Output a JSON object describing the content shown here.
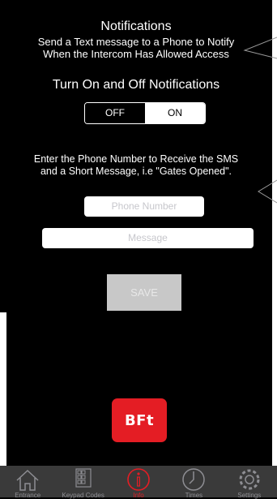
{
  "notifications": {
    "title": "Notifications",
    "description_line1": "Send a Text message to  a Phone to Notify",
    "description_line2": "When the Intercom Has Allowed Access",
    "toggle_heading": "Turn On and Off Notifications",
    "toggle": {
      "off_label": "OFF",
      "on_label": "ON",
      "selected": "ON"
    }
  },
  "sms": {
    "instruction_line1": "Enter the Phone Number to Receive the SMS",
    "instruction_line2": "and a Short Message, i.e \"Gates Opened\".",
    "phone_placeholder": "Phone Number",
    "message_placeholder": "Message",
    "save_label": "SAVE"
  },
  "logo": {
    "text": "BFt",
    "color": "#e41d24"
  },
  "tabs": [
    {
      "label": "Entrance",
      "icon": "home-icon"
    },
    {
      "label": "Keypad Codes",
      "icon": "keypad-icon"
    },
    {
      "label": "Info",
      "icon": "info-icon",
      "active": true
    },
    {
      "label": "Times",
      "icon": "clock-icon"
    },
    {
      "label": "Settings",
      "icon": "gear-icon"
    }
  ],
  "colors": {
    "accent": "#e41d24",
    "tabbar_bg": "#3a3a3a",
    "background": "#000000"
  }
}
